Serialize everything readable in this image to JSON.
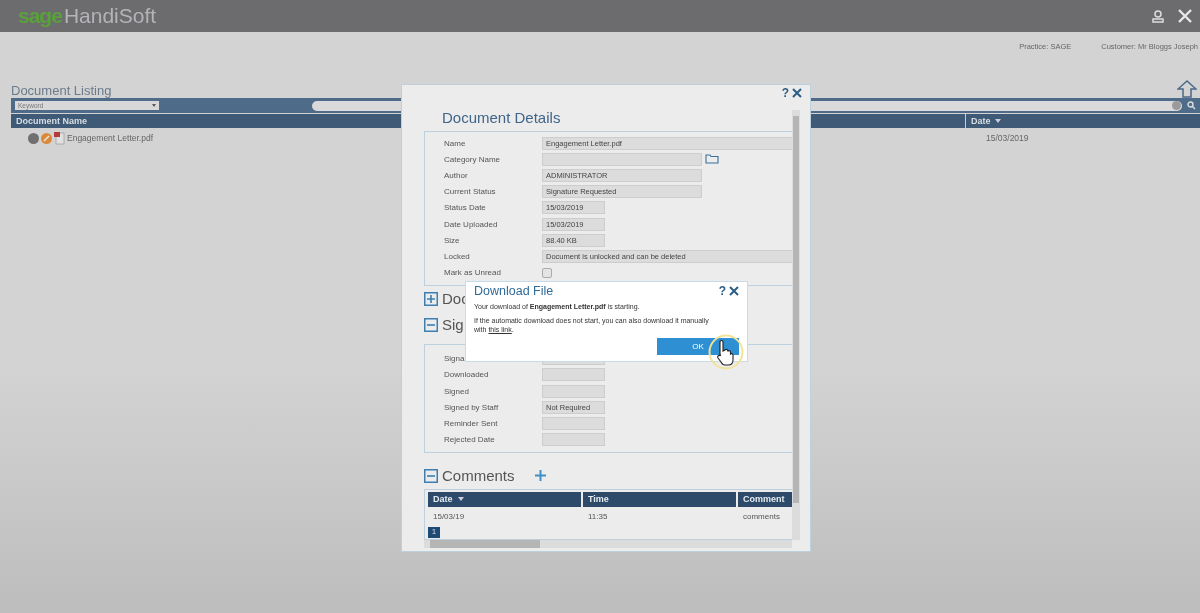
{
  "app": {
    "brand": "sage",
    "product": "HandiSoft"
  },
  "header": {
    "practice": "Practice: SAGE",
    "customer": "Customer: Mr Bloggs Joseph"
  },
  "listing": {
    "title": "Document Listing",
    "filter": "Keyword",
    "columns": [
      {
        "label": "Document Name",
        "sorted": false
      },
      {
        "label": "Date",
        "sorted": true
      }
    ],
    "rows": [
      {
        "name": "Engagement Letter.pdf",
        "date": "15/03/2019"
      }
    ]
  },
  "details": {
    "help": "?",
    "title": "Document Details",
    "fields": [
      {
        "label": "Name",
        "value": "Engagement Letter.pdf",
        "kind": "wide"
      },
      {
        "label": "Category Name",
        "kind": "folder"
      },
      {
        "label": "Author",
        "value": "ADMINISTRATOR",
        "kind": "medium"
      },
      {
        "label": "Current Status",
        "value": "Signature Requested",
        "kind": "medium"
      },
      {
        "label": "Status Date",
        "value": "15/03/2019",
        "kind": "narrow"
      },
      {
        "label": "Date Uploaded",
        "value": "15/03/2019",
        "kind": "narrow"
      },
      {
        "label": "Size",
        "value": "88.40 KB",
        "kind": "narrow"
      },
      {
        "label": "Locked",
        "value": "Document is unlocked and can be deleted",
        "kind": "wide"
      },
      {
        "label": "Mark as Unread",
        "kind": "checkbox",
        "checked": false
      }
    ],
    "sections": [
      {
        "title": "Doc",
        "expanded": false
      },
      {
        "title": "Sig",
        "expanded": true
      }
    ],
    "signature_fields": [
      {
        "label": "Signa"
      },
      {
        "label": "Downloaded"
      },
      {
        "label": "Signed"
      },
      {
        "label": "Signed by Staff",
        "value": "Not Required"
      },
      {
        "label": "Reminder Sent"
      },
      {
        "label": "Rejected Date"
      }
    ],
    "comments": {
      "title": "Comments",
      "expanded": true,
      "columns": [
        {
          "label": "Date",
          "sorted": true
        },
        {
          "label": "Time",
          "sorted": false
        },
        {
          "label": "Comment",
          "sorted": false
        }
      ],
      "rows": [
        [
          "15/03/19",
          "11:35",
          "comments"
        ]
      ],
      "pages": [
        {
          "label": "1",
          "selected": true
        }
      ]
    }
  },
  "download": {
    "title": "Download File",
    "help": "?",
    "message": "Your download of **Engagement Letter.pdf** is starting.",
    "fallback": "If the automatic download does not start, you can also download it manually with ",
    "link": "this link",
    "after_link": ".",
    "button": "OK"
  }
}
